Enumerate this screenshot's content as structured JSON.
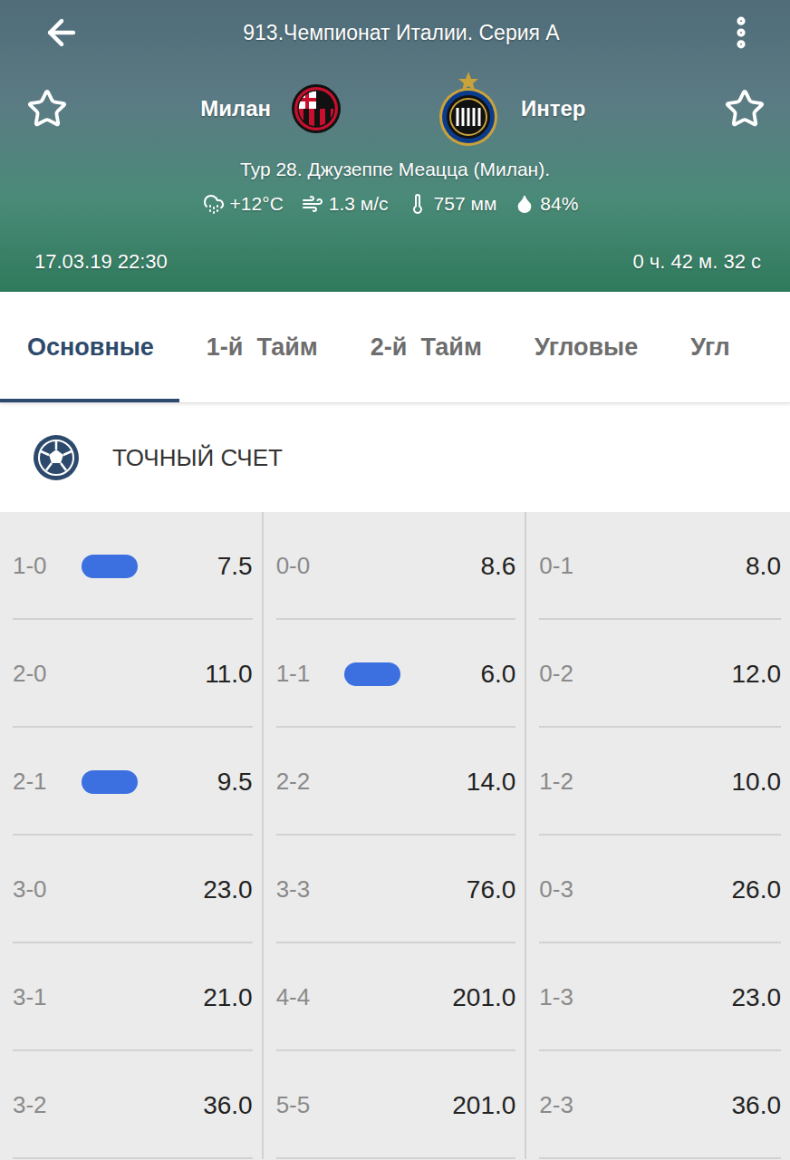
{
  "header": {
    "title": "913.Чемпионат Италии. Серия А",
    "home_team": {
      "name": "Милан",
      "favorite": false
    },
    "away_team": {
      "name": "Интер",
      "favorite": false
    },
    "venue": "Тур 28. Джузеппе Меацца (Милан).",
    "weather": {
      "temperature": "+12°C",
      "wind": "1.3 м/с",
      "pressure": "757 мм",
      "humidity": "84%"
    },
    "datetime": "17.03.19 22:30",
    "countdown": "0 ч. 42 м. 32 с"
  },
  "tabs": [
    {
      "label": "Основные",
      "selected": true
    },
    {
      "label": "1-й  Тайм",
      "selected": false
    },
    {
      "label": "2-й  Тайм",
      "selected": false
    },
    {
      "label": "Угловые",
      "selected": false
    },
    {
      "label": "Угл",
      "selected": false
    }
  ],
  "market": {
    "title": "ТОЧНЫЙ СЧЕТ"
  },
  "scores": [
    [
      {
        "score": "1-0",
        "odds": "7.5",
        "marked": true
      },
      {
        "score": "0-0",
        "odds": "8.6",
        "marked": false
      },
      {
        "score": "0-1",
        "odds": "8.0",
        "marked": false
      }
    ],
    [
      {
        "score": "2-0",
        "odds": "11.0",
        "marked": false
      },
      {
        "score": "1-1",
        "odds": "6.0",
        "marked": true
      },
      {
        "score": "0-2",
        "odds": "12.0",
        "marked": false
      }
    ],
    [
      {
        "score": "2-1",
        "odds": "9.5",
        "marked": true
      },
      {
        "score": "2-2",
        "odds": "14.0",
        "marked": false
      },
      {
        "score": "1-2",
        "odds": "10.0",
        "marked": false
      }
    ],
    [
      {
        "score": "3-0",
        "odds": "23.0",
        "marked": false
      },
      {
        "score": "3-3",
        "odds": "76.0",
        "marked": false
      },
      {
        "score": "0-3",
        "odds": "26.0",
        "marked": false
      }
    ],
    [
      {
        "score": "3-1",
        "odds": "21.0",
        "marked": false
      },
      {
        "score": "4-4",
        "odds": "201.0",
        "marked": false
      },
      {
        "score": "1-3",
        "odds": "23.0",
        "marked": false
      }
    ],
    [
      {
        "score": "3-2",
        "odds": "36.0",
        "marked": false
      },
      {
        "score": "5-5",
        "odds": "201.0",
        "marked": false
      },
      {
        "score": "2-3",
        "odds": "36.0",
        "marked": false
      }
    ]
  ]
}
